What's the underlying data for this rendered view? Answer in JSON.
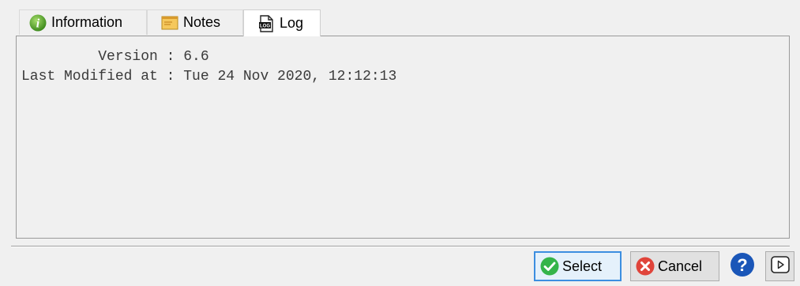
{
  "tabs": [
    {
      "label": "Information",
      "icon": "info-icon"
    },
    {
      "label": "Notes",
      "icon": "notes-icon"
    },
    {
      "label": "Log",
      "icon": "log-icon",
      "active": true
    }
  ],
  "log": {
    "lines": [
      "         Version : 6.6",
      "Last Modified at : Tue 24 Nov 2020, 12:12:13"
    ]
  },
  "buttons": {
    "select_label": "Select",
    "cancel_label": "Cancel"
  },
  "colors": {
    "select_border": "#3c8ee0",
    "check_green": "#35b44a",
    "cancel_red": "#e0443a",
    "help_blue": "#1a56b8",
    "info_green": "#5aa52c"
  }
}
